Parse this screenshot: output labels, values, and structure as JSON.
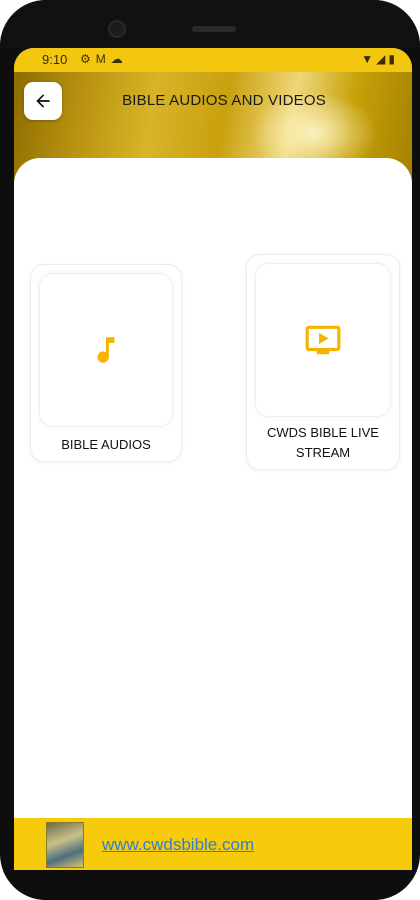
{
  "status_bar": {
    "time": "9:10",
    "left_icons": [
      "gear-icon",
      "gmail-icon",
      "cloud-icon"
    ],
    "right_icons": [
      "wifi-icon",
      "signal-icon",
      "battery-icon"
    ]
  },
  "header": {
    "title": "BIBLE AUDIOS AND VIDEOS",
    "back_icon": "arrow-left-icon"
  },
  "cards": [
    {
      "label": "BIBLE AUDIOS",
      "icon": "music-note-icon"
    },
    {
      "label": "CWDS BIBLE LIVE STREAM",
      "icon": "tv-play-icon"
    }
  ],
  "footer": {
    "link_text": "www.cwdsbible.com"
  },
  "colors": {
    "accent_gold": "#f5cb0c",
    "icon_gold": "#f4b400",
    "link_blue": "#2e7fd6"
  }
}
